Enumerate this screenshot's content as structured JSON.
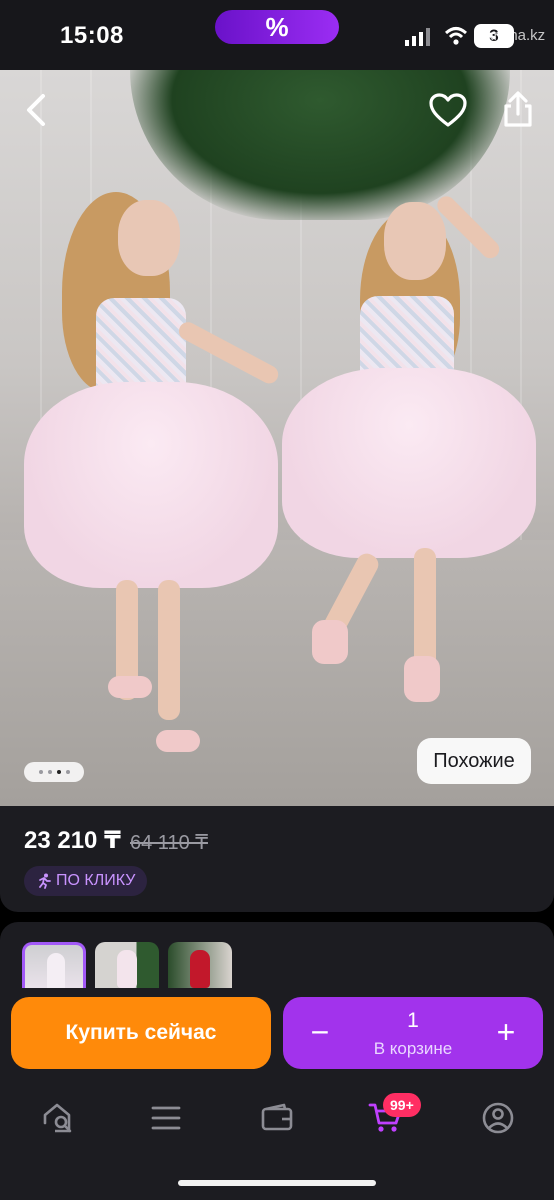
{
  "status_bar": {
    "time": "15:08",
    "promo_symbol": "%",
    "battery": "3",
    "watermark": "krisha.kz"
  },
  "product": {
    "image_pager_dots": 4,
    "active_dot": 3,
    "similar_label": "Похожие"
  },
  "pricing": {
    "current_price": "23 210 ₸",
    "old_price": "64 110 ₸",
    "promo_badge": "ПО КЛИКУ"
  },
  "actions": {
    "buy_now_label": "Купить сейчас",
    "cart_quantity": "1",
    "cart_label": "В корзине",
    "minus_symbol": "−",
    "plus_symbol": "+"
  },
  "bottom_nav": {
    "cart_badge": "99+",
    "items": [
      "home-search-icon",
      "catalog-menu-icon",
      "wallet-icon",
      "cart-icon",
      "profile-icon"
    ]
  },
  "colors": {
    "accent_purple": "#a233ec",
    "buy_orange": "#ff8a0a",
    "badge_pink": "#ff2e63",
    "panel_bg": "#1c1c21"
  }
}
